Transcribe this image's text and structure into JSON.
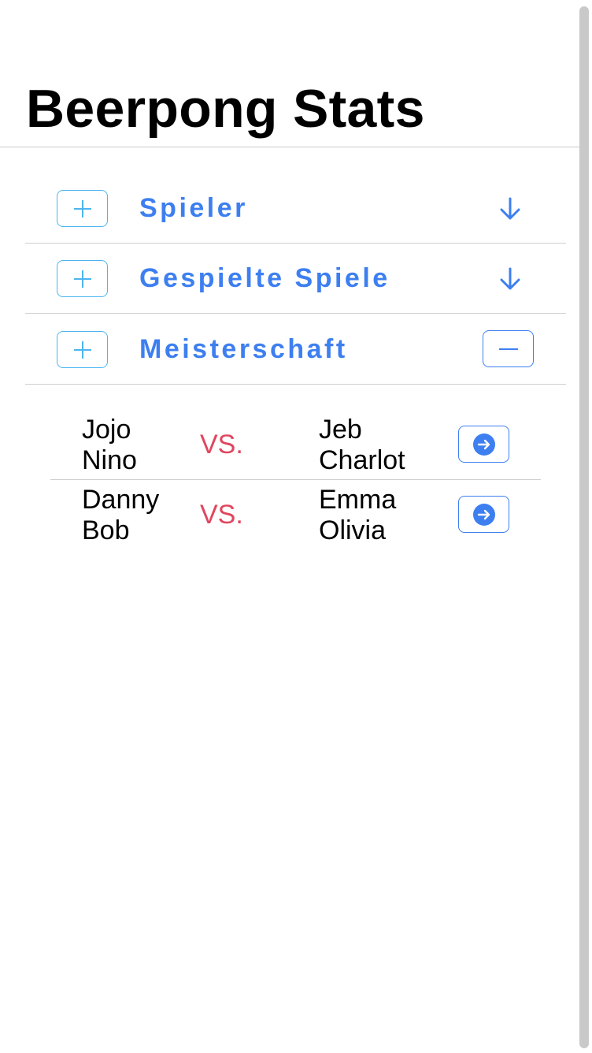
{
  "app": {
    "title": "Beerpong Stats"
  },
  "colors": {
    "accent": "#3d7ff0",
    "add_border": "#4cb5f0",
    "vs": "#e0465e"
  },
  "sections": [
    {
      "label": "Spieler",
      "add_icon": "plus-icon",
      "toggle_icon": "arrow-down-icon",
      "expanded": false
    },
    {
      "label": "Gespielte Spiele",
      "add_icon": "plus-icon",
      "toggle_icon": "arrow-down-icon",
      "expanded": false
    },
    {
      "label": "Meisterschaft",
      "add_icon": "plus-icon",
      "toggle_icon": "minus-icon",
      "expanded": true
    }
  ],
  "matches": [
    {
      "team1": [
        "Jojo",
        "Nino"
      ],
      "vs": "VS.",
      "team2": [
        "Jeb",
        "Charlot"
      ],
      "action_icon": "arrow-right-circle-icon"
    },
    {
      "team1": [
        "Danny",
        "Bob"
      ],
      "vs": "VS.",
      "team2": [
        "Emma",
        "Olivia"
      ],
      "action_icon": "arrow-right-circle-icon"
    }
  ]
}
